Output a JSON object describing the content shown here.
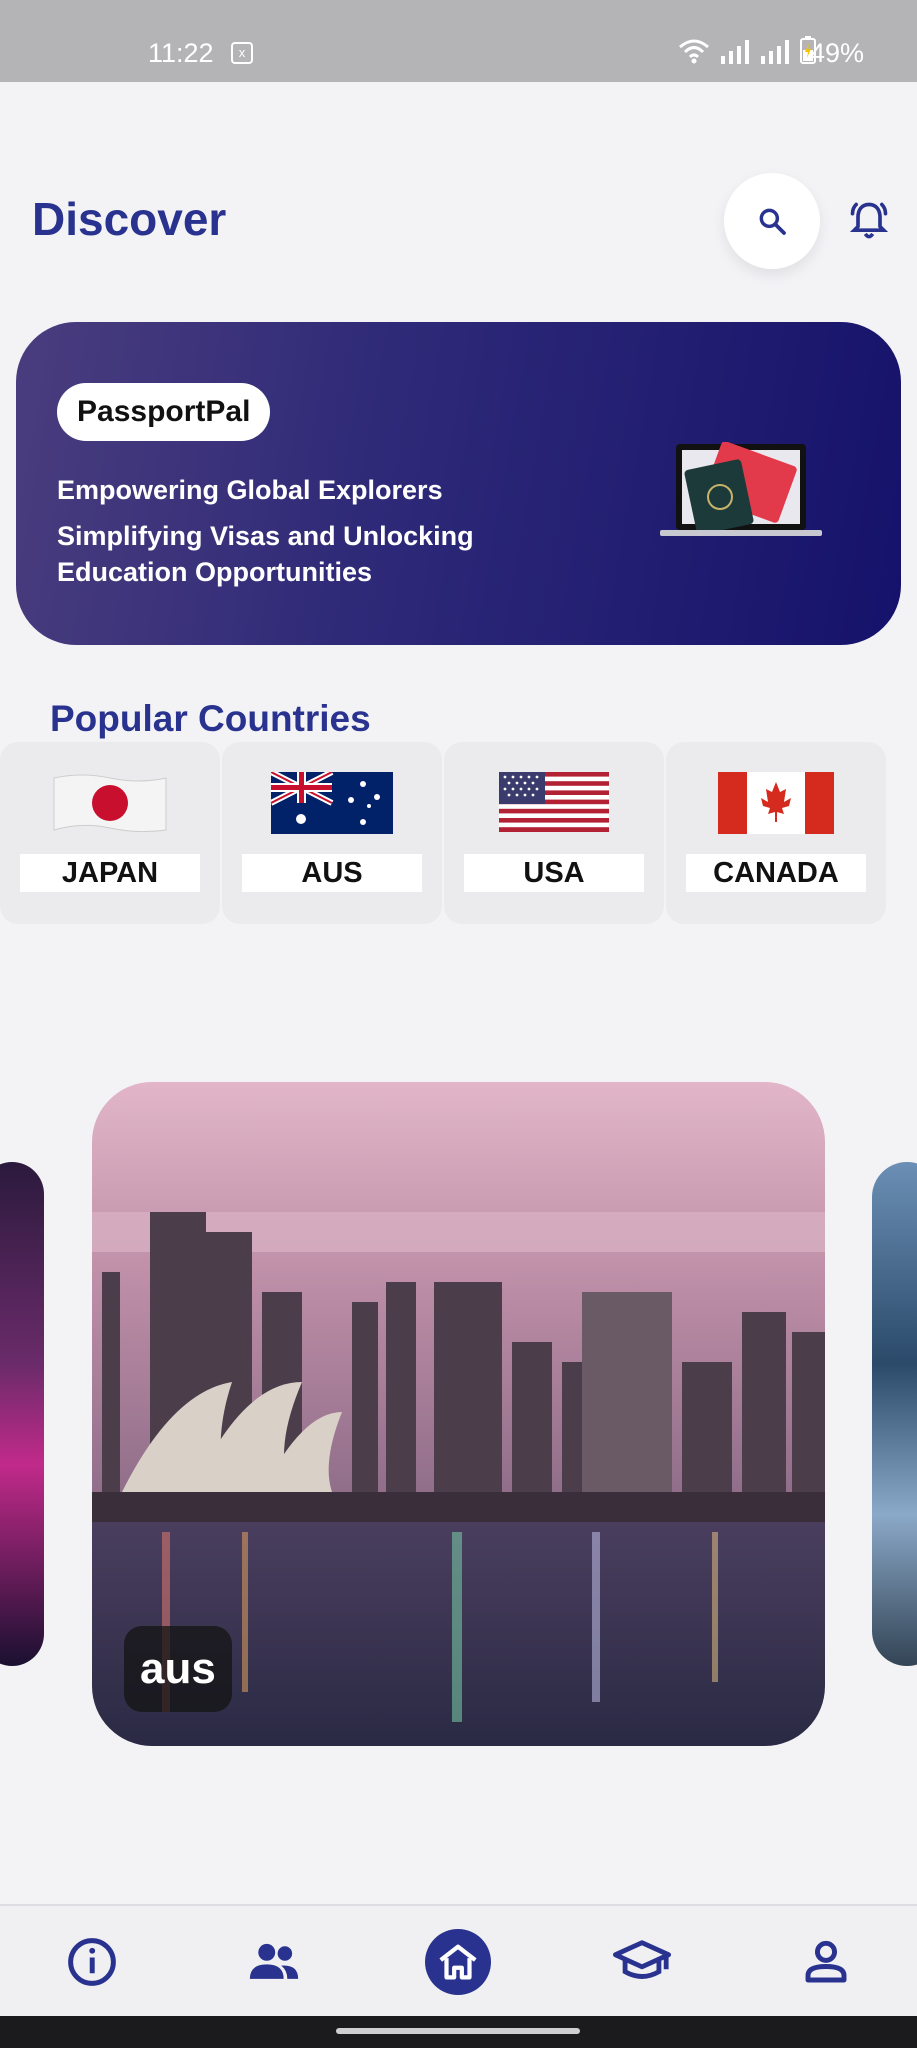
{
  "status_bar": {
    "time": "11:22",
    "notification_glyph": "x",
    "battery_text": "49%"
  },
  "header": {
    "title": "Discover"
  },
  "banner": {
    "pill_label": "PassportPal",
    "line1": "Empowering Global Explorers",
    "line2": "Simplifying Visas and Unlocking Education Opportunities"
  },
  "popular": {
    "title": "Popular Countries",
    "countries": [
      {
        "label": "JAPAN",
        "flag": "japan-flag"
      },
      {
        "label": "AUS",
        "flag": "australia-flag"
      },
      {
        "label": "USA",
        "flag": "usa-flag"
      },
      {
        "label": "CANADA",
        "flag": "canada-flag"
      }
    ]
  },
  "carousel": {
    "caption": "aus"
  },
  "bottom_nav": {
    "items": [
      "info-icon",
      "community-icon",
      "home-icon",
      "education-icon",
      "profile-icon"
    ],
    "active": "home-icon"
  },
  "colors": {
    "accent": "#29338f",
    "banner_start": "#4a3d7e",
    "banner_end": "#15126b",
    "background": "#f3f3f6"
  }
}
